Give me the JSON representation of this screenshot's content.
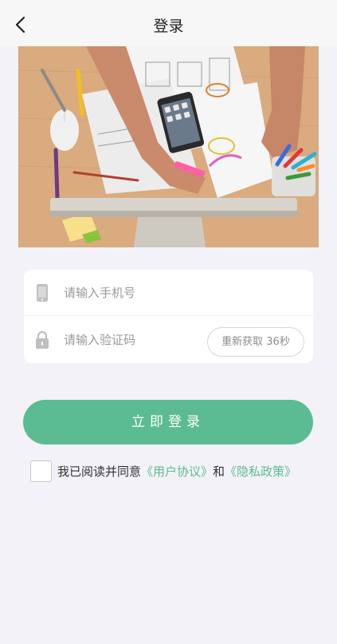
{
  "header": {
    "title": "登录",
    "back_icon": "chevron-left-icon"
  },
  "hero": {
    "image_desc": "desk-with-phone-and-papers"
  },
  "form": {
    "phone_placeholder": "请输入手机号",
    "phone_icon": "phone-icon",
    "code_placeholder": "请输入验证码",
    "code_icon": "lock-icon",
    "resend_label": "重新获取 36秒"
  },
  "login_button": {
    "label": "立即登录"
  },
  "agreement": {
    "prefix": "我已阅读并同意",
    "user_agreement": "《用户协议》",
    "joiner": "和",
    "privacy_policy": "《隐私政策》"
  },
  "colors": {
    "accent": "#5bbc93",
    "background": "#f3f2f8"
  }
}
